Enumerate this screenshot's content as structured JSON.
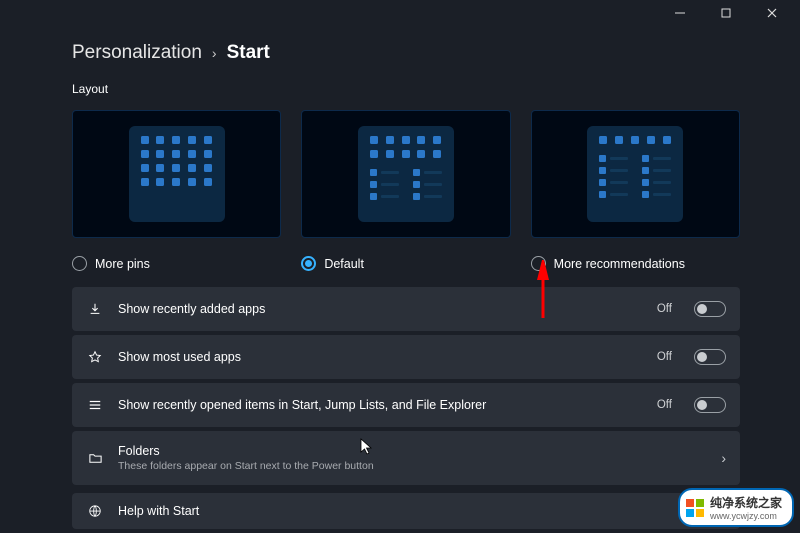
{
  "titlebar": {
    "min": "—",
    "max": "▢",
    "close": "✕"
  },
  "breadcrumb": {
    "parent": "Personalization",
    "chevron": "›",
    "current": "Start"
  },
  "section": {
    "label": "Layout"
  },
  "layouts": {
    "options": [
      {
        "id": "more-pins",
        "label": "More pins",
        "selected": false
      },
      {
        "id": "default",
        "label": "Default",
        "selected": true
      },
      {
        "id": "more-recs",
        "label": "More recommendations",
        "selected": false
      }
    ]
  },
  "rows": {
    "recently_added": {
      "label": "Show recently added apps",
      "state": "Off"
    },
    "most_used": {
      "label": "Show most used apps",
      "state": "Off"
    },
    "recent_items": {
      "label": "Show recently opened items in Start, Jump Lists, and File Explorer",
      "state": "Off"
    },
    "folders": {
      "label": "Folders",
      "sub": "These folders appear on Start next to the Power button"
    },
    "help": {
      "label": "Help with Start"
    }
  },
  "watermark": {
    "title": "纯净系统之家",
    "url": "www.ycwjzy.com"
  }
}
